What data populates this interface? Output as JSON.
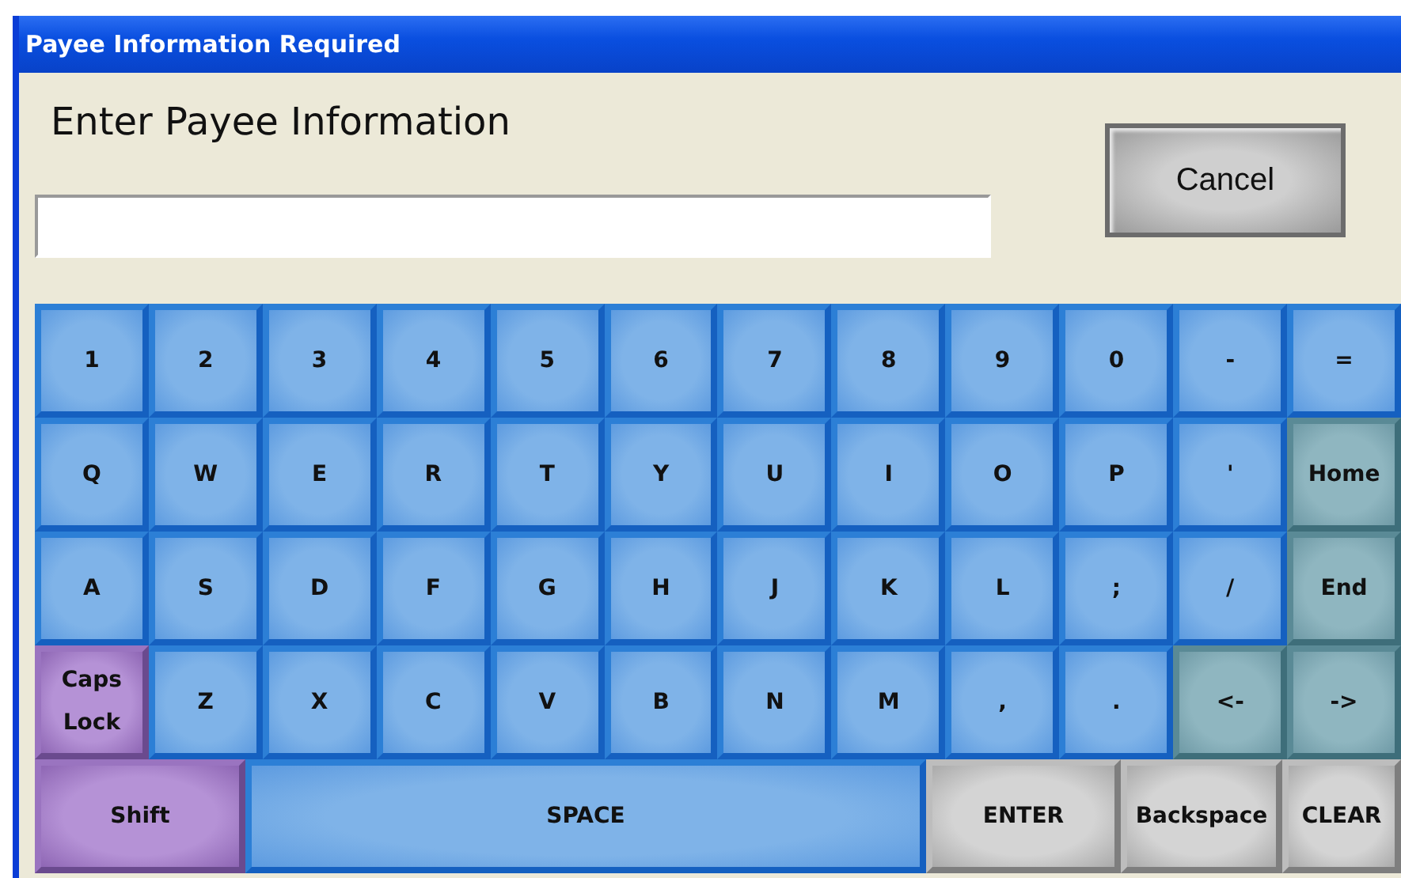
{
  "window": {
    "title": "Payee Information Required"
  },
  "heading": "Enter Payee Information",
  "cancel_button": "Cancel",
  "keyboard": {
    "rows": [
      [
        {
          "label": "1",
          "kind": "blue"
        },
        {
          "label": "2",
          "kind": "blue"
        },
        {
          "label": "3",
          "kind": "blue"
        },
        {
          "label": "4",
          "kind": "blue"
        },
        {
          "label": "5",
          "kind": "blue"
        },
        {
          "label": "6",
          "kind": "blue"
        },
        {
          "label": "7",
          "kind": "blue"
        },
        {
          "label": "8",
          "kind": "blue"
        },
        {
          "label": "9",
          "kind": "blue"
        },
        {
          "label": "0",
          "kind": "blue"
        },
        {
          "label": "-",
          "kind": "blue"
        },
        {
          "label": "=",
          "kind": "blue"
        }
      ],
      [
        {
          "label": "Q",
          "kind": "blue"
        },
        {
          "label": "W",
          "kind": "blue"
        },
        {
          "label": "E",
          "kind": "blue"
        },
        {
          "label": "R",
          "kind": "blue"
        },
        {
          "label": "T",
          "kind": "blue"
        },
        {
          "label": "Y",
          "kind": "blue"
        },
        {
          "label": "U",
          "kind": "blue"
        },
        {
          "label": "I",
          "kind": "blue"
        },
        {
          "label": "O",
          "kind": "blue"
        },
        {
          "label": "P",
          "kind": "blue"
        },
        {
          "label": "'",
          "kind": "blue"
        },
        {
          "label": "Home",
          "kind": "teal"
        }
      ],
      [
        {
          "label": "A",
          "kind": "blue"
        },
        {
          "label": "S",
          "kind": "blue"
        },
        {
          "label": "D",
          "kind": "blue"
        },
        {
          "label": "F",
          "kind": "blue"
        },
        {
          "label": "G",
          "kind": "blue"
        },
        {
          "label": "H",
          "kind": "blue"
        },
        {
          "label": "J",
          "kind": "blue"
        },
        {
          "label": "K",
          "kind": "blue"
        },
        {
          "label": "L",
          "kind": "blue"
        },
        {
          "label": ";",
          "kind": "blue"
        },
        {
          "label": "/",
          "kind": "blue"
        },
        {
          "label": "End",
          "kind": "teal"
        }
      ],
      [
        {
          "label": "Caps Lock",
          "kind": "purple"
        },
        {
          "label": "Z",
          "kind": "blue"
        },
        {
          "label": "X",
          "kind": "blue"
        },
        {
          "label": "C",
          "kind": "blue"
        },
        {
          "label": "V",
          "kind": "blue"
        },
        {
          "label": "B",
          "kind": "blue"
        },
        {
          "label": "N",
          "kind": "blue"
        },
        {
          "label": "M",
          "kind": "blue"
        },
        {
          "label": ",",
          "kind": "blue"
        },
        {
          "label": ".",
          "kind": "blue"
        },
        {
          "label": "<-",
          "kind": "teal"
        },
        {
          "label": "->",
          "kind": "teal"
        }
      ]
    ],
    "bottom_keys": [
      {
        "label": "Shift",
        "kind": "purple"
      },
      {
        "label": "SPACE",
        "kind": "blue"
      },
      {
        "label": "ENTER",
        "kind": "gray"
      },
      {
        "label": "Backspace",
        "kind": "gray"
      },
      {
        "label": "CLEAR",
        "kind": "gray"
      }
    ]
  }
}
